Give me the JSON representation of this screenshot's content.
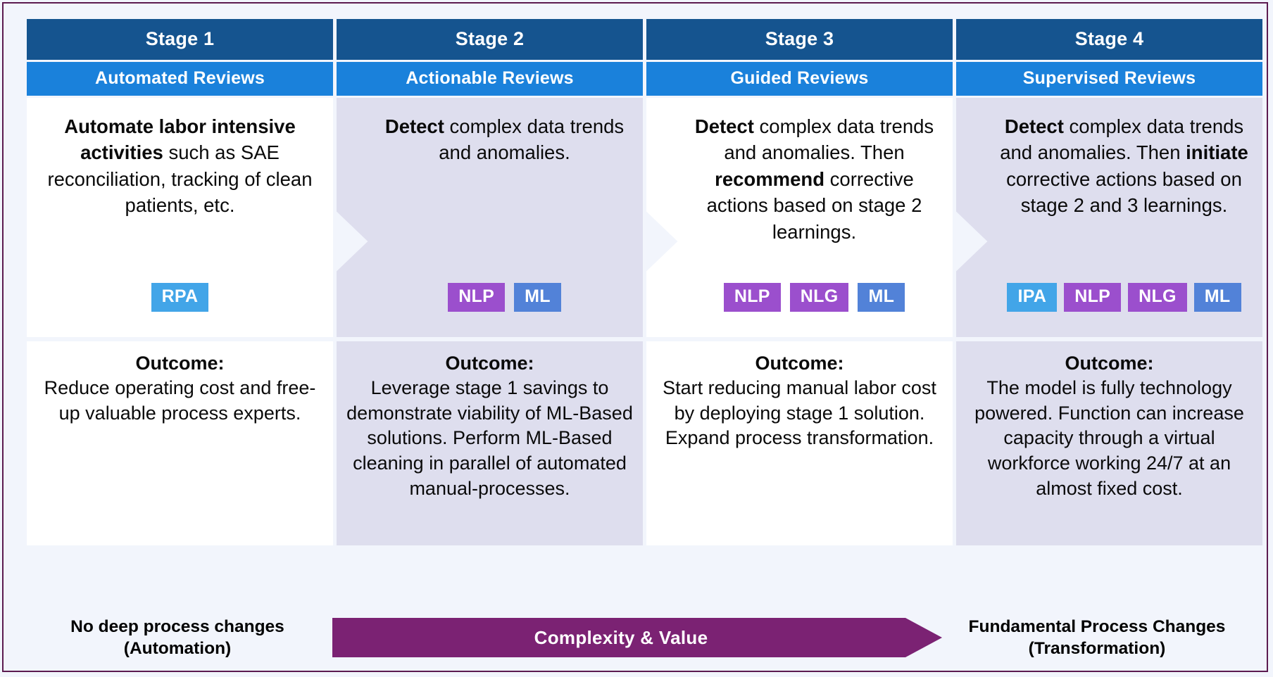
{
  "colors": {
    "header_dark": "#15548F",
    "header_light": "#1A81DB",
    "panel_white": "#FFFFFF",
    "panel_lilac": "#DEDEEE",
    "arrow_purple": "#7B2273",
    "tag_blue_light": "#42A5E8",
    "tag_purple": "#9B4FCD",
    "tag_blue_medium": "#5282D8",
    "page_background": "#F2F5FC",
    "outer_border": "#5C1B50"
  },
  "stages": [
    {
      "title": "Stage 1",
      "subtitle": "Automated Reviews",
      "body_html": "<b>Automate labor intensive activities</b> such as SAE reconciliation, tracking of clean patients, etc.",
      "tags": [
        "RPA"
      ],
      "outcome_title": "Outcome:",
      "outcome_text": "Reduce operating cost and free-up valuable process experts."
    },
    {
      "title": "Stage 2",
      "subtitle": "Actionable Reviews",
      "body_html": "<b>Detect</b> complex data trends and anomalies.",
      "tags": [
        "NLP",
        "ML"
      ],
      "outcome_title": "Outcome:",
      "outcome_text": "Leverage stage 1 savings to demonstrate viability of ML-Based solutions. Perform ML-Based cleaning in parallel of automated manual-processes."
    },
    {
      "title": "Stage 3",
      "subtitle": "Guided Reviews",
      "body_html": "<b>Detect</b> complex data trends and anomalies. Then <b>recommend</b> corrective actions based on stage 2 learnings.",
      "tags": [
        "NLP",
        "NLG",
        "ML"
      ],
      "outcome_title": "Outcome:",
      "outcome_text": "Start reducing manual labor cost by deploying stage 1 solution. Expand process transformation."
    },
    {
      "title": "Stage 4",
      "subtitle": "Supervised Reviews",
      "body_html": "<b>Detect</b> complex data trends and anomalies. Then <b>initiate</b> corrective actions based on stage 2 and 3 learnings.",
      "tags": [
        "IPA",
        "NLP",
        "NLG",
        "ML"
      ],
      "outcome_title": "Outcome:",
      "outcome_text": "The model is fully technology powered. Function can increase capacity through a virtual workforce working 24/7 at an almost fixed cost."
    }
  ],
  "footer": {
    "left_label": "No deep process changes (Automation)",
    "arrow_label": "Complexity &  Value",
    "right_label": "Fundamental Process Changes (Transformation)"
  }
}
